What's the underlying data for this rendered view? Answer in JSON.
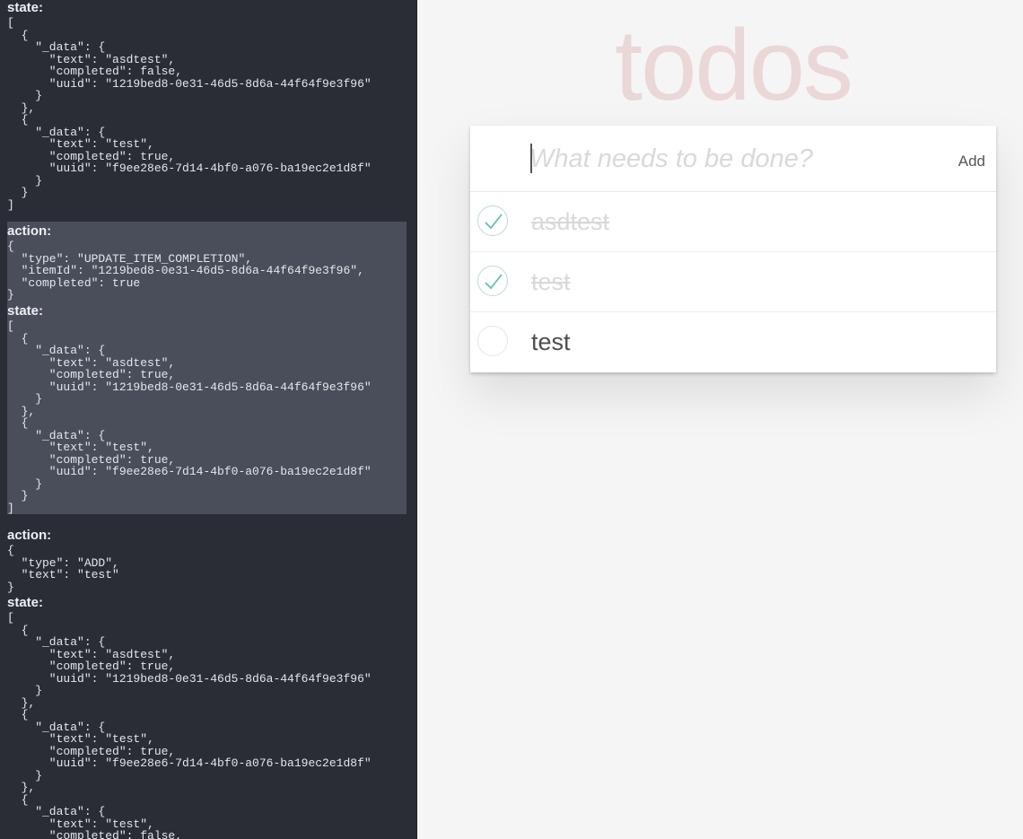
{
  "debug": {
    "blocks": [
      {
        "state_label": "state:",
        "state": "[\n  {\n    \"_data\": {\n      \"text\": \"asdtest\",\n      \"completed\": false,\n      \"uuid\": \"1219bed8-0e31-46d5-8d6a-44f64f9e3f96\"\n    }\n  },\n  {\n    \"_data\": {\n      \"text\": \"test\",\n      \"completed\": true,\n      \"uuid\": \"f9ee28e6-7d14-4bf0-a076-ba19ec2e1d8f\"\n    }\n  }\n]"
      },
      {
        "action_label": "action:",
        "action": "{\n  \"type\": \"UPDATE_ITEM_COMPLETION\",\n  \"itemId\": \"1219bed8-0e31-46d5-8d6a-44f64f9e3f96\",\n  \"completed\": true\n}",
        "state_label": "state:",
        "state": "[\n  {\n    \"_data\": {\n      \"text\": \"asdtest\",\n      \"completed\": true,\n      \"uuid\": \"1219bed8-0e31-46d5-8d6a-44f64f9e3f96\"\n    }\n  },\n  {\n    \"_data\": {\n      \"text\": \"test\",\n      \"completed\": true,\n      \"uuid\": \"f9ee28e6-7d14-4bf0-a076-ba19ec2e1d8f\"\n    }\n  }\n]"
      },
      {
        "action_label": "action:",
        "action": "{\n  \"type\": \"ADD\",\n  \"text\": \"test\"\n}",
        "state_label": "state:",
        "state": "[\n  {\n    \"_data\": {\n      \"text\": \"asdtest\",\n      \"completed\": true,\n      \"uuid\": \"1219bed8-0e31-46d5-8d6a-44f64f9e3f96\"\n    }\n  },\n  {\n    \"_data\": {\n      \"text\": \"test\",\n      \"completed\": true,\n      \"uuid\": \"f9ee28e6-7d14-4bf0-a076-ba19ec2e1d8f\"\n    }\n  },\n  {\n    \"_data\": {\n      \"text\": \"test\",\n      \"completed\": false,"
      }
    ]
  },
  "app": {
    "title": "todos",
    "input_placeholder": "What needs to be done?",
    "input_value": "",
    "add_label": "Add",
    "items": [
      {
        "text": "asdtest",
        "completed": true
      },
      {
        "text": "test",
        "completed": true
      },
      {
        "text": "test",
        "completed": false
      }
    ]
  },
  "colors": {
    "panel_bg": "#2a2d35",
    "highlight_bg": "#4a4e5a",
    "check_green": "#5dc2af",
    "title_color": "#ead7d7"
  }
}
